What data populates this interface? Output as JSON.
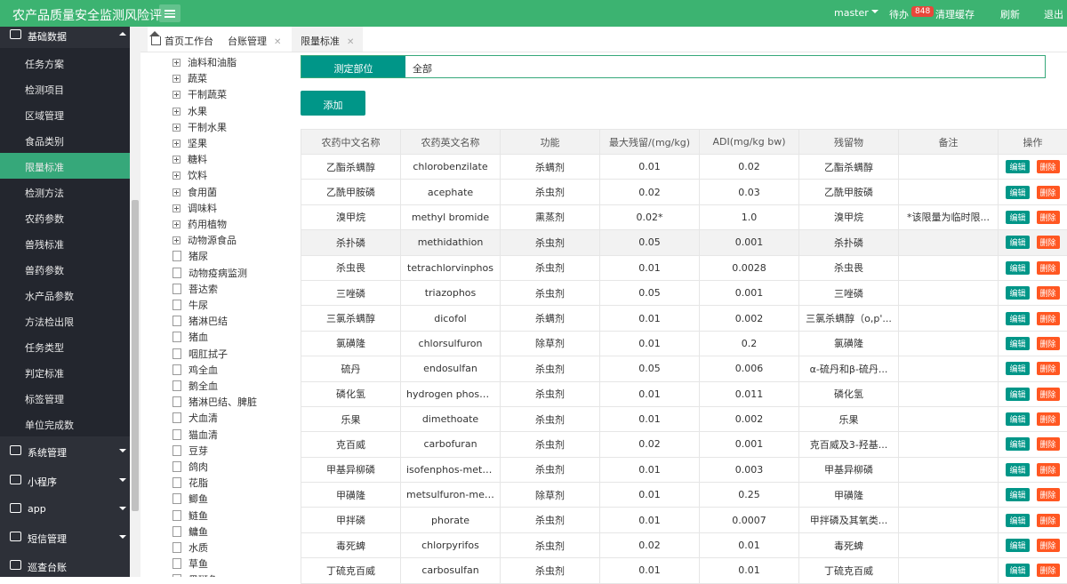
{
  "header": {
    "app_title": "农产品质量安全监测风险评",
    "user": "master",
    "pending_label": "待办",
    "pending_count": "848",
    "clear_cache": "清理缓存",
    "refresh": "刷新",
    "logout": "退出"
  },
  "sidebar": {
    "group_title": "基础数据",
    "items": [
      {
        "label": "任务方案"
      },
      {
        "label": "检测项目"
      },
      {
        "label": "区域管理"
      },
      {
        "label": "食品类别"
      },
      {
        "label": "限量标准",
        "active": true
      },
      {
        "label": "检测方法"
      },
      {
        "label": "农药参数"
      },
      {
        "label": "兽残标准"
      },
      {
        "label": "兽药参数"
      },
      {
        "label": "水产品参数"
      },
      {
        "label": "方法检出限"
      },
      {
        "label": "任务类型"
      },
      {
        "label": "判定标准"
      },
      {
        "label": "标签管理"
      },
      {
        "label": "单位完成数"
      }
    ],
    "groups": [
      {
        "label": "系统管理"
      },
      {
        "label": "小程序"
      },
      {
        "label": "app"
      },
      {
        "label": "短信管理"
      },
      {
        "label": "巡查台账"
      }
    ]
  },
  "tabs": [
    {
      "label": "首页工作台"
    },
    {
      "label": "台账管理"
    },
    {
      "label": "限量标准"
    }
  ],
  "tree": {
    "folders": [
      "油料和油脂",
      "蔬菜",
      "干制蔬菜",
      "水果",
      "干制水果",
      "坚果",
      "糖料",
      "饮料",
      "食用菌",
      "调味料",
      "药用植物",
      "动物源食品"
    ],
    "files": [
      "猪尿",
      "动物疫病监测",
      "菩达索",
      "牛尿",
      "猪淋巴结",
      "猪血",
      "咽肛拭子",
      "鸡全血",
      "鹅全血",
      "猪淋巴结、脾脏",
      "犬血清",
      "猫血清",
      "豆芽",
      "鸽肉",
      "花脂",
      "鲫鱼",
      "鲢鱼",
      "鳙鱼",
      "水质",
      "草鱼",
      "黑斑鱼"
    ]
  },
  "filter": {
    "label": "测定部位",
    "value": "全部"
  },
  "add_button": "添加",
  "table": {
    "headers": [
      "农药中文名称",
      "农药英文名称",
      "功能",
      "最大残留/(mg/kg)",
      "ADI(mg/kg bw)",
      "残留物",
      "备注",
      "操作"
    ],
    "edit_label": "编辑",
    "delete_label": "删除",
    "rows": [
      [
        "乙酯杀螨醇",
        "chlorobenzilate",
        "杀螨剂",
        "0.01",
        "0.02",
        "乙酯杀螨醇",
        ""
      ],
      [
        "乙酰甲胺磷",
        "acephate",
        "杀虫剂",
        "0.02",
        "0.03",
        "乙酰甲胺磷",
        ""
      ],
      [
        "溴甲烷",
        "methyl bromide",
        "熏蒸剂",
        "0.02*",
        "1.0",
        "溴甲烷",
        "*该限量为临时限..."
      ],
      [
        "杀扑磷",
        "methidathion",
        "杀虫剂",
        "0.05",
        "0.001",
        "杀扑磷",
        ""
      ],
      [
        "杀虫畏",
        "tetrachlorvinphos",
        "杀虫剂",
        "0.01",
        "0.0028",
        "杀虫畏",
        ""
      ],
      [
        "三唑磷",
        "triazophos",
        "杀虫剂",
        "0.05",
        "0.001",
        "三唑磷",
        ""
      ],
      [
        "三氯杀螨醇",
        "dicofol",
        "杀螨剂",
        "0.01",
        "0.002",
        "三氯杀螨醇（o,p'...",
        ""
      ],
      [
        "氯磺隆",
        "chlorsulfuron",
        "除草剂",
        "0.01",
        "0.2",
        "氯磺隆",
        ""
      ],
      [
        "硫丹",
        "endosulfan",
        "杀虫剂",
        "0.05",
        "0.006",
        "α-硫丹和β-硫丹...",
        ""
      ],
      [
        "磷化氢",
        "hydrogen phosphide",
        "杀虫剂",
        "0.01",
        "0.011",
        "磷化氢",
        ""
      ],
      [
        "乐果",
        "dimethoate",
        "杀虫剂",
        "0.01",
        "0.002",
        "乐果",
        ""
      ],
      [
        "克百威",
        "carbofuran",
        "杀虫剂",
        "0.02",
        "0.001",
        "克百威及3-羟基...",
        ""
      ],
      [
        "甲基异柳磷",
        "isofenphos-methyl",
        "杀虫剂",
        "0.01",
        "0.003",
        "甲基异柳磷",
        ""
      ],
      [
        "甲磺隆",
        "metsulfuron-methyl",
        "除草剂",
        "0.01",
        "0.25",
        "甲磺隆",
        ""
      ],
      [
        "甲拌磷",
        "phorate",
        "杀虫剂",
        "0.01",
        "0.0007",
        "甲拌磷及其氧类...",
        ""
      ],
      [
        "毒死蜱",
        "chlorpyrifos",
        "杀虫剂",
        "0.02",
        "0.01",
        "毒死蜱",
        ""
      ],
      [
        "丁硫克百威",
        "carbosulfan",
        "杀虫剂",
        "0.01",
        "0.01",
        "丁硫克百威",
        ""
      ]
    ]
  }
}
